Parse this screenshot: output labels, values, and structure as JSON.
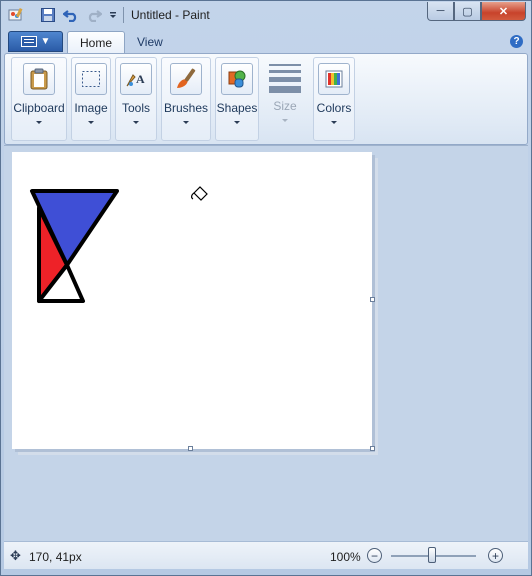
{
  "window": {
    "title": "Untitled - Paint",
    "controls": {
      "minimize": "─",
      "maximize": "▢",
      "close": "✕"
    }
  },
  "quick_access": {
    "app_icon": "paint-app-icon",
    "save_icon": "save-icon",
    "undo_icon": "undo-icon",
    "redo_icon": "redo-icon",
    "customize_icon": "customize-dropdown-icon"
  },
  "tabs": [
    {
      "label": "Home",
      "active": true
    },
    {
      "label": "View",
      "active": false
    }
  ],
  "help_label": "?",
  "ribbon": {
    "groups": [
      {
        "label": "Clipboard",
        "icon": "clipboard-icon",
        "enabled": true
      },
      {
        "label": "Image",
        "icon": "select-icon",
        "enabled": true
      },
      {
        "label": "Tools",
        "icon": "tools-icon",
        "enabled": true
      },
      {
        "label": "Brushes",
        "icon": "brush-icon",
        "enabled": true
      },
      {
        "label": "Shapes",
        "icon": "shapes-icon",
        "enabled": true
      },
      {
        "label": "Size",
        "icon": "size-icon",
        "enabled": false
      },
      {
        "label": "Colors",
        "icon": "colors-icon",
        "enabled": true
      }
    ]
  },
  "canvas": {
    "shapes": [
      {
        "name": "blue-triangle",
        "fill": "#3f4fd6"
      },
      {
        "name": "red-triangle",
        "fill": "#ee2228"
      },
      {
        "name": "white-triangle",
        "fill": "#ffffff"
      }
    ],
    "cursor": "fill-bucket-cursor"
  },
  "status": {
    "coordinates": "170, 41px",
    "zoom": "100%",
    "zoom_out": "−",
    "zoom_in": "+"
  },
  "colors": {
    "accent": "#2a5ba7",
    "close_button": "#c8432b"
  }
}
